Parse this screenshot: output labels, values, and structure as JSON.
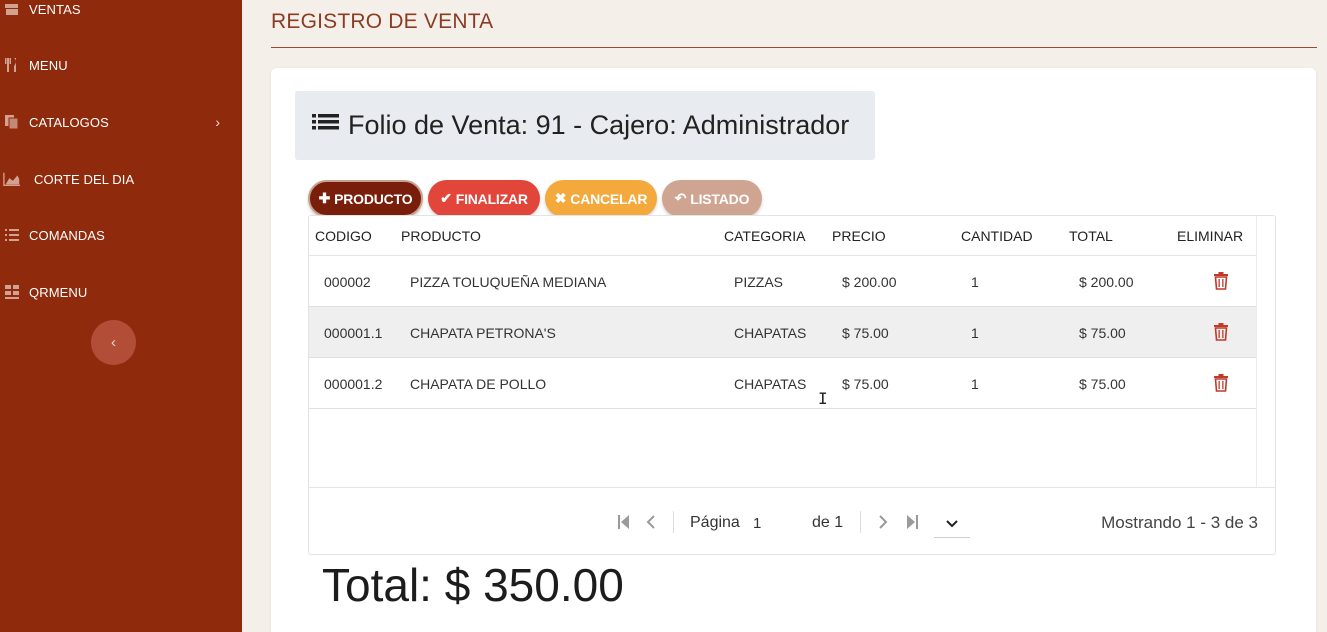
{
  "sidebar": {
    "items": [
      {
        "label": "VENTAS",
        "icon": "cash-register-icon"
      },
      {
        "label": "MENU",
        "icon": "utensils-icon"
      },
      {
        "label": "CATALOGOS",
        "icon": "documents-icon",
        "has_submenu": true
      },
      {
        "label": "CORTE DEL DIA",
        "icon": "area-chart-icon"
      },
      {
        "label": "COMANDAS",
        "icon": "list-icon"
      },
      {
        "label": "QRMENU",
        "icon": "qr-grid-icon"
      }
    ],
    "submenu_chevron": "›",
    "collapse_glyph": "‹"
  },
  "header": {
    "title": "REGISTRO DE VENTA"
  },
  "folio": {
    "text": "Folio de Venta: 91 - Cajero: Administrador"
  },
  "actions": {
    "producto": "PRODUCTO",
    "finalizar": "FINALIZAR",
    "cancelar": "CANCELAR",
    "listado": "LISTADO"
  },
  "table": {
    "columns": [
      "CODIGO",
      "PRODUCTO",
      "CATEGORIA",
      "PRECIO",
      "CANTIDAD",
      "TOTAL",
      "ELIMINAR"
    ],
    "rows": [
      {
        "codigo": "000002",
        "producto": "PIZZA TOLUQUEÑA MEDIANA",
        "categoria": "PIZZAS",
        "precio": "$ 200.00",
        "cantidad": "1",
        "total": "$ 200.00"
      },
      {
        "codigo": "000001.1",
        "producto": "CHAPATA PETRONA'S",
        "categoria": "CHAPATAS",
        "precio": "$ 75.00",
        "cantidad": "1",
        "total": "$ 75.00"
      },
      {
        "codigo": "000001.2",
        "producto": "CHAPATA DE POLLO",
        "categoria": "CHAPATAS",
        "precio": "$ 75.00",
        "cantidad": "1",
        "total": "$ 75.00"
      }
    ]
  },
  "pager": {
    "page_label": "Página",
    "page_value": "1",
    "of_label": "de 1",
    "info": "Mostrando 1 - 3 de 3"
  },
  "total": {
    "text": "Total: $ 350.00"
  },
  "colors": {
    "sidebar": "#8f2a0c",
    "title": "#8a3d24",
    "producto": "#7a1e0c",
    "finalizar": "#e2463a",
    "cancelar": "#f4a93d",
    "listado": "#cfa592",
    "trash": "#c0392b"
  }
}
